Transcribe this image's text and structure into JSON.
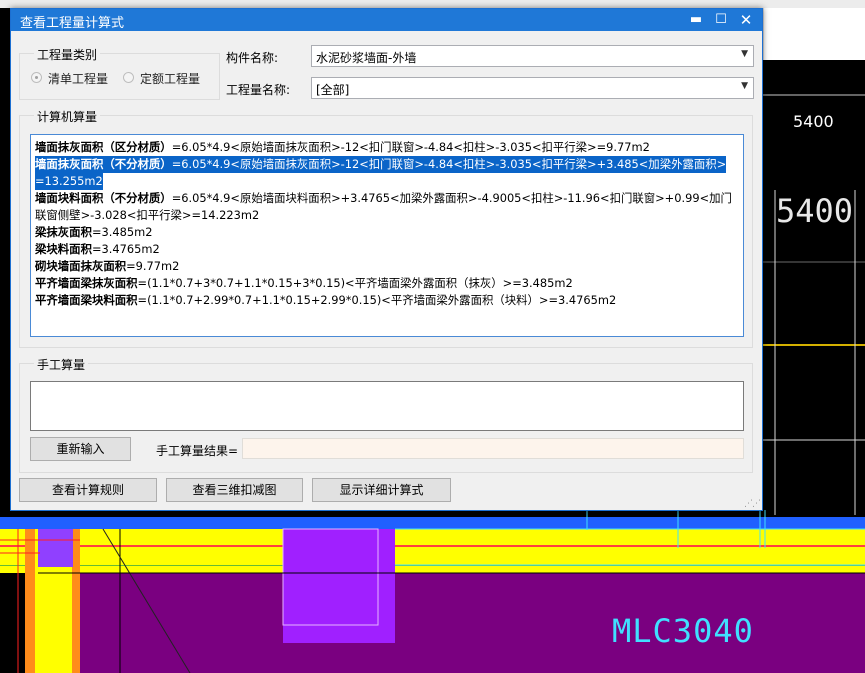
{
  "cad": {
    "dim_top": "5400",
    "dim_large": "5400",
    "label_window": "MLC3040"
  },
  "dialog": {
    "title": "查看工程量计算式",
    "controls": {
      "minimize": "▬",
      "maximize": "☐",
      "close": "✕"
    },
    "quantity_type": {
      "legend": "工程量类别",
      "option_1": "清单工程量",
      "option_2": "定额工程量",
      "selected": "清单工程量"
    },
    "component": {
      "label": "构件名称:",
      "value": "水泥砂浆墙面-外墙"
    },
    "quantity_name": {
      "label": "工程量名称:",
      "value": "[全部]"
    },
    "computed": {
      "legend": "计算机算量",
      "lines": [
        {
          "name": "墙面抹灰面积（区分材质）",
          "formula": "=6.05*4.9<原始墙面抹灰面积>-12<扣门联窗>-4.84<扣柱>-3.035<扣平行梁>=9.77m2"
        },
        {
          "name": "墙面抹灰面积（不分材质）",
          "formula": "=6.05*4.9<原始墙面抹灰面积>-12<扣门联窗>-4.84<扣柱>-3.035<扣平行梁>+3.485<加梁外露面积>"
        },
        {
          "name": "",
          "formula": "=13.255m2"
        },
        {
          "name": "墙面块料面积（不分材质）",
          "formula": "=6.05*4.9<原始墙面块料面积>+3.4765<加梁外露面积>-4.9005<扣柱>-11.96<扣门联窗>+0.99<加门"
        },
        {
          "name": "",
          "formula": "联窗侧壁>-3.028<扣平行梁>=14.223m2"
        },
        {
          "name": "梁抹灰面积",
          "formula": "=3.485m2"
        },
        {
          "name": "梁块料面积",
          "formula": "=3.4765m2"
        },
        {
          "name": "砌块墙面抹灰面积",
          "formula": "=9.77m2"
        },
        {
          "name": "平齐墙面梁抹灰面积",
          "formula": "=(1.1*0.7+3*0.7+1.1*0.15+3*0.15)<平齐墙面梁外露面积（抹灰）>=3.485m2"
        },
        {
          "name": "平齐墙面梁块料面积",
          "formula": "=(1.1*0.7+2.99*0.7+1.1*0.15+2.99*0.15)<平齐墙面梁外露面积（块料）>=3.4765m2"
        }
      ]
    },
    "manual": {
      "legend": "手工算量",
      "input_value": "",
      "reinput_button": "重新输入",
      "result_label": "手工算量结果=",
      "result_value": ""
    },
    "buttons": {
      "view_rules": "查看计算规则",
      "view_3d": "查看三维扣减图",
      "show_detail": "显示详细计算式"
    }
  }
}
